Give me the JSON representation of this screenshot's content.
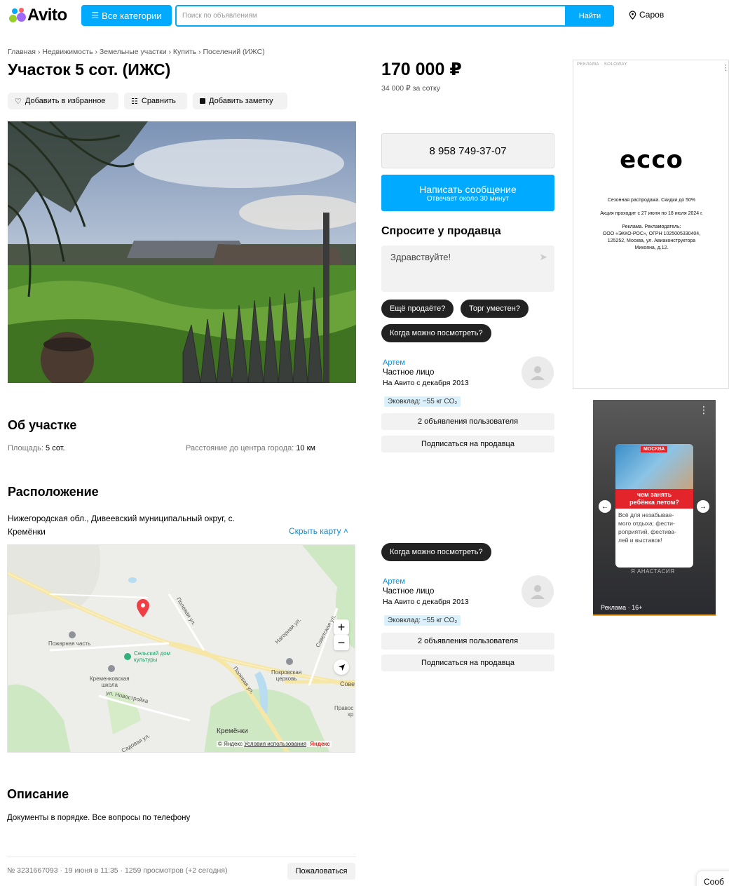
{
  "header": {
    "logo_text": "Avito",
    "categories_label": "Все категории",
    "search_placeholder": "Поиск по объявлениям",
    "search_button": "Найти",
    "city": "Саров"
  },
  "breadcrumbs": [
    "Главная",
    "Недвижимость",
    "Земельные участки",
    "Купить",
    "Поселений (ИЖС)"
  ],
  "title": "Участок 5 сот. (ИЖС)",
  "actions": {
    "favorite": "Добавить в избранное",
    "compare": "Сравнить",
    "note": "Добавить заметку"
  },
  "about": {
    "heading": "Об участке",
    "area_label": "Площадь:",
    "area_value": "5 сот.",
    "distance_label": "Расстояние до центра города:",
    "distance_value": "10 км"
  },
  "location": {
    "heading": "Расположение",
    "address_line1": "Нижегородская обл., Дивеевский муниципальный округ, с.",
    "address_line2": "Кремёнки",
    "hide_map": "Скрыть карту ˄"
  },
  "map": {
    "labels": {
      "fire": "Пожарная часть",
      "culture1": "Сельский дом",
      "culture2": "культуры",
      "school1": "Кременковская",
      "school2": "школа",
      "novostroyka": "ул. Новостройка",
      "polevaya1": "Полевая ул.",
      "polevaya2": "Полевая ул.",
      "nagornaya": "Нагорная ул.",
      "sovetskaya": "Советская ул.",
      "church1": "Покровская",
      "church2": "церковь",
      "sove": "Сове",
      "pravos1": "Правос",
      "pravos2": "хр",
      "kremenki": "Кремёнки",
      "sadovaya": "Садовая ул."
    },
    "copyright": "© Яндекс",
    "terms": "Условия использования",
    "brand": "Яндекс"
  },
  "description": {
    "heading": "Описание",
    "text": "Документы в порядке. Все вопросы по телефону"
  },
  "footer": {
    "meta": "№ 3231667093 · 19 июня в 11:35 · 1259 просмотров (+2 сегодня)",
    "report": "Пожаловаться",
    "chat_cut": "Сооб"
  },
  "pricing": {
    "price": "170 000 ₽",
    "per_unit": "34 000 ₽ за сотку"
  },
  "contact": {
    "phone": "8 958 749-37-07",
    "message_button": "Написать сообщение",
    "message_sub": "Отвечает около 30 минут"
  },
  "ask": {
    "heading": "Спросите у продавца",
    "input_value": "Здравствуйте!",
    "chips": [
      "Ещё продаёте?",
      "Торг уместен?",
      "Когда можно посмотреть?"
    ],
    "chip_repeat": "Когда можно посмотреть?"
  },
  "seller": {
    "name": "Артем",
    "type": "Частное лицо",
    "since": "На Авито с декабря 2013",
    "eco": "Эковклад: −55 кг CO₂",
    "listings": "2 объявления пользователя",
    "subscribe": "Подписаться на продавца"
  },
  "ad_ecco": {
    "label": "РЕКЛАМА · SOLOWAY",
    "brand": "ecco",
    "line1": "Сезонная распродажа. Скидки до 50%",
    "line2": "Акция проходит с 27 июня по 18 июля 2024 г.",
    "line3": "Реклама. Рекламодатель:",
    "line4": "ООО «ЭККО-РОС», ОГРН 1025005330404,",
    "line5": "125252, Москва, ул. Авиаконструктора",
    "line6": "Микояна, д.12."
  },
  "ad_moscow": {
    "badge": "МОСКВА",
    "headline1": "чем занять",
    "headline2": "ребёнка летом?",
    "text1": "Всё для незабывае-",
    "text2": "мого отдыха: фести-",
    "text3": "роприятий, фестива-",
    "text4": "лей и выставок!",
    "author": "Я АНАСТАСИЯ",
    "label": "Реклама · 16+"
  },
  "colors": {
    "accent": "#00aaff",
    "chip": "#222222",
    "link": "#0a8ed8",
    "ad_red": "#e3242b"
  }
}
